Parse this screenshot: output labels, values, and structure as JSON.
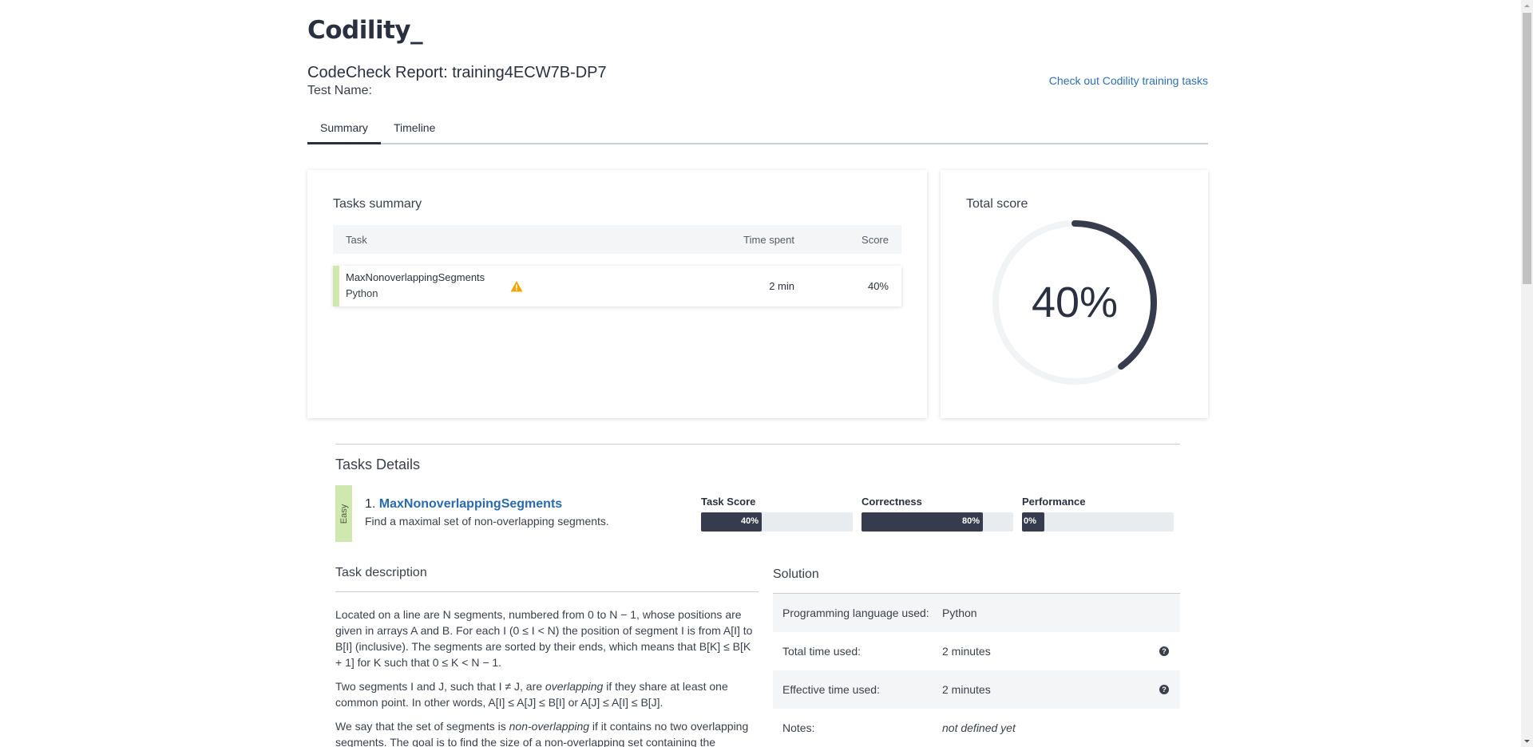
{
  "header": {
    "logo": "Codility_",
    "report_title": "CodeCheck Report: training4ECW7B-DP7",
    "test_name_label": "Test Name:",
    "training_link": "Check out Codility training tasks"
  },
  "tabs": [
    {
      "label": "Summary",
      "active": true
    },
    {
      "label": "Timeline",
      "active": false
    }
  ],
  "tasks_summary": {
    "title": "Tasks summary",
    "columns": [
      "Task",
      "Time spent",
      "Score"
    ],
    "rows": [
      {
        "name": "MaxNonoverlappingSegments",
        "language": "Python",
        "warning_icon": "warning-icon",
        "time": "2 min",
        "score": "40%"
      }
    ]
  },
  "total_score": {
    "title": "Total score",
    "value": "40%",
    "fraction": 0.4
  },
  "tasks_details": {
    "title": "Tasks Details",
    "difficulty": "Easy",
    "task_number": "1.",
    "task_name": "MaxNonoverlappingSegments",
    "task_subtitle": "Find a maximal set of non-overlapping segments.",
    "metrics": [
      {
        "label": "Task Score",
        "value": "40%",
        "fraction": 0.4
      },
      {
        "label": "Correctness",
        "value": "80%",
        "fraction": 0.8
      },
      {
        "label": "Performance",
        "value": "0%",
        "fraction": 0.0
      }
    ]
  },
  "task_description": {
    "title": "Task description",
    "p1": "Located on a line are N segments, numbered from 0 to N − 1, whose positions are given in arrays A and B. For each I (0 ≤ I < N) the position of segment I is from A[I] to B[I] (inclusive). The segments are sorted by their ends, which means that B[K] ≤ B[K + 1] for K such that 0 ≤ K < N − 1.",
    "p2_a": "Two segments I and J, such that I ≠ J, are ",
    "p2_em": "overlapping",
    "p2_b": " if they share at least one common point. In other words, A[I] ≤ A[J] ≤ B[I] or A[J] ≤ A[I] ≤ B[J].",
    "p3_a": "We say that the set of segments is ",
    "p3_em": "non-overlapping",
    "p3_b": " if it contains no two overlapping segments. The goal is to find the size of a non-overlapping set containing the"
  },
  "solution": {
    "title": "Solution",
    "rows": [
      {
        "key": "Programming language used:",
        "value": "Python"
      },
      {
        "key": "Total time used:",
        "value": "2 minutes"
      },
      {
        "key": "Effective time used:",
        "value": "2 minutes"
      },
      {
        "key": "Notes:",
        "value": "not defined yet"
      }
    ],
    "help_glyph": "?"
  },
  "colors": {
    "accent_dark": "#363b4d",
    "link": "#2a6aad",
    "easy_badge": "#cfe8b0",
    "warning": "#f0a500"
  }
}
